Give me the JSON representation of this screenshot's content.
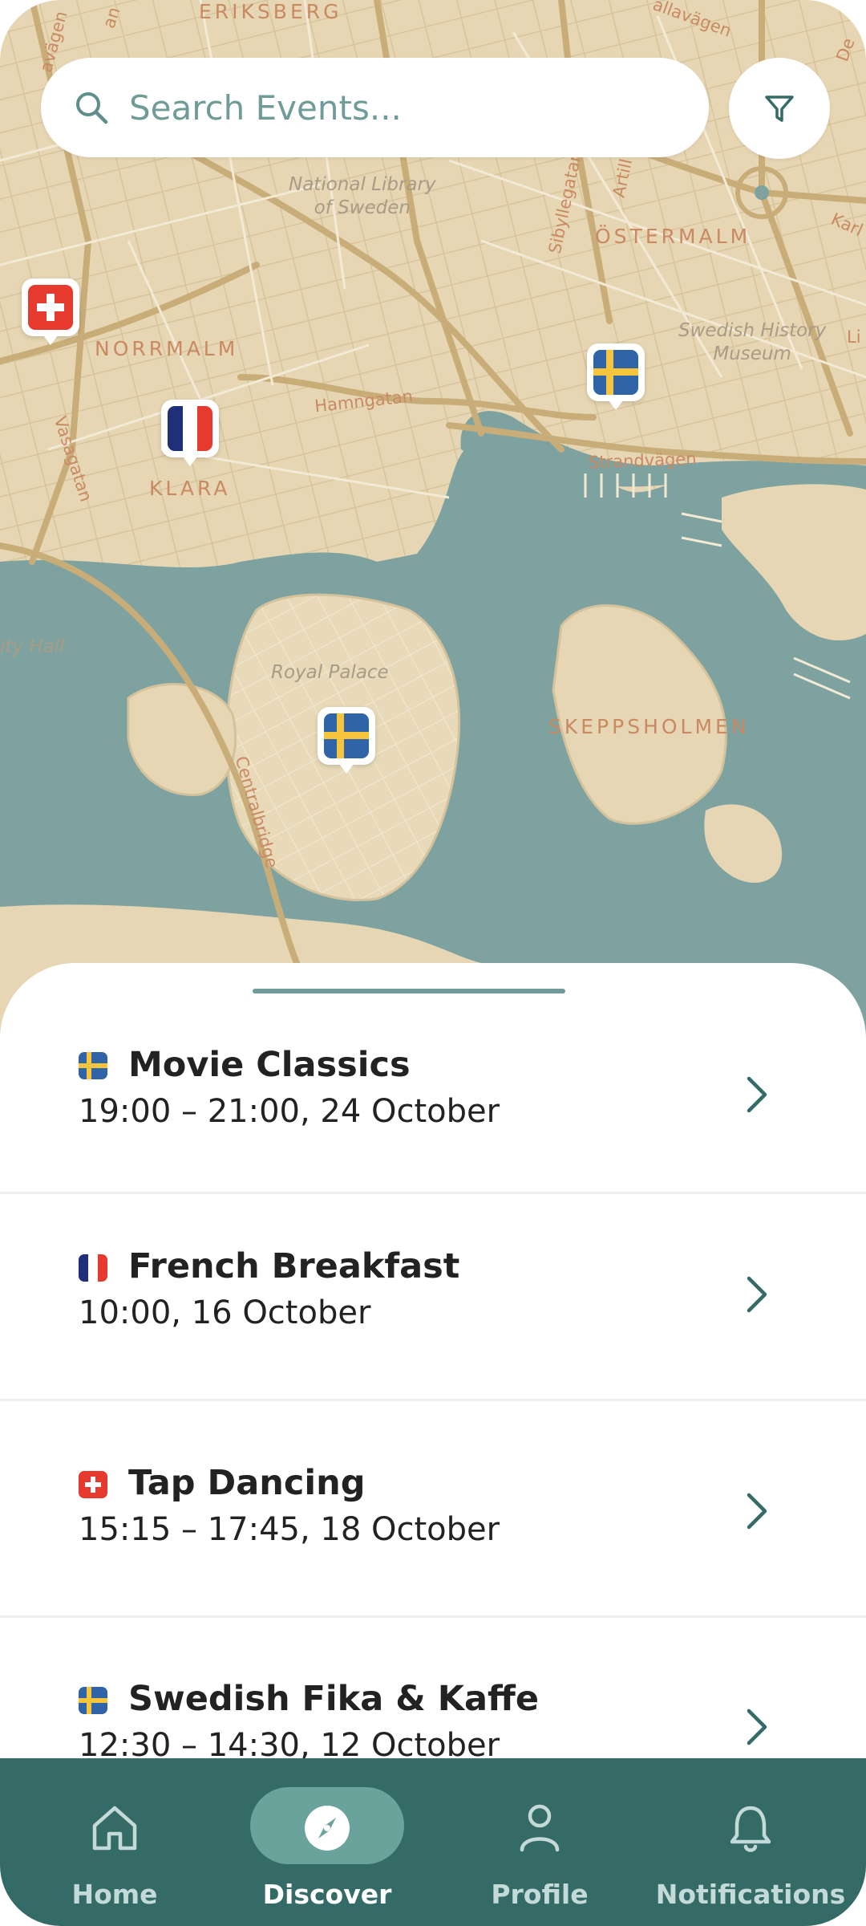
{
  "search": {
    "placeholder": "Search Events..."
  },
  "map": {
    "districts": {
      "eriksberg": "ERIKSBERG",
      "normalm": "NORRMALM",
      "klara": "KLARA",
      "ostermalm": "ÖSTERMALM",
      "skeppsholmen": "SKEPPSHOLMEN"
    },
    "streets": {
      "hamngatan": "Hamngatan",
      "vasagatan": "Vasagatan",
      "strandvagen": "Strandvägen",
      "sibyllegatan": "Sibyllegatan",
      "artillerigatan": "Artill",
      "tullvagen": "allavägen",
      "savage": "avägen",
      "centralbridge": "Centralbridge",
      "karl": "Karl",
      "li": "Li",
      "de": "De",
      "han": "an"
    },
    "pois": {
      "national_library": "National Library\nof Sweden",
      "swedish_history": "Swedish History\nMuseum",
      "royal_palace": "Royal Palace",
      "city_hall": "ity Hall"
    },
    "markers": [
      {
        "flag": "switzerland"
      },
      {
        "flag": "france"
      },
      {
        "flag": "sweden"
      },
      {
        "flag": "sweden"
      }
    ]
  },
  "events": [
    {
      "flag": "sweden",
      "title": "Movie Classics",
      "time": "19:00 – 21:00,  24 October"
    },
    {
      "flag": "france",
      "title": "French Breakfast",
      "time": "10:00, 16 October"
    },
    {
      "flag": "switzerland",
      "title": "Tap Dancing",
      "time": "15:15 – 17:45, 18 October"
    },
    {
      "flag": "sweden",
      "title": "Swedish Fika & Kaffe",
      "time": "12:30 – 14:30, 12 October"
    }
  ],
  "nav": {
    "items": [
      {
        "label": "Home",
        "icon": "home-icon"
      },
      {
        "label": "Discover",
        "icon": "compass-icon",
        "active": true
      },
      {
        "label": "Profile",
        "icon": "person-icon"
      },
      {
        "label": "Notifications",
        "icon": "bell-icon"
      }
    ]
  },
  "colors": {
    "map_land": "#e6d6b3",
    "map_water": "#7da29f",
    "primary": "#356b66",
    "accent": "#6aa29c",
    "street_label": "#c98a63"
  }
}
